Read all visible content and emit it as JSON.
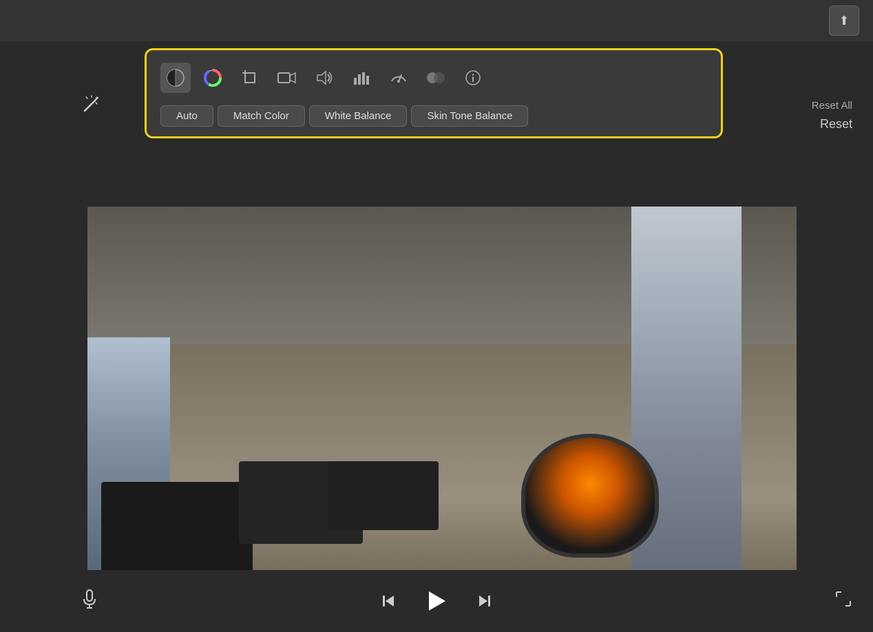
{
  "topbar": {
    "share_icon": "⬆"
  },
  "toolbar": {
    "icons": [
      {
        "name": "color-correction-icon",
        "symbol": "◐",
        "active": true
      },
      {
        "name": "color-wheels-icon",
        "symbol": "🎨",
        "active": false
      },
      {
        "name": "crop-icon",
        "symbol": "⊡",
        "active": false
      },
      {
        "name": "video-camera-icon",
        "symbol": "📹",
        "active": false
      },
      {
        "name": "audio-icon",
        "symbol": "🔊",
        "active": false
      },
      {
        "name": "histogram-icon",
        "symbol": "📊",
        "active": false
      },
      {
        "name": "speedometer-icon",
        "symbol": "⏱",
        "active": false
      },
      {
        "name": "blending-icon",
        "symbol": "⚫",
        "active": false
      },
      {
        "name": "info-icon",
        "symbol": "ℹ",
        "active": false
      }
    ],
    "sub_tabs": [
      {
        "label": "Auto",
        "active": false
      },
      {
        "label": "Match Color",
        "active": false
      },
      {
        "label": "White Balance",
        "active": false
      },
      {
        "label": "Skin Tone Balance",
        "active": false
      }
    ],
    "reset_all_label": "Reset All",
    "reset_label": "Reset"
  },
  "playback": {
    "mic_icon": "🎤",
    "skip_back_icon": "⏮",
    "play_icon": "▶",
    "skip_forward_icon": "⏭",
    "expand_icon": "⤢"
  },
  "magic_wand_icon": "✦"
}
